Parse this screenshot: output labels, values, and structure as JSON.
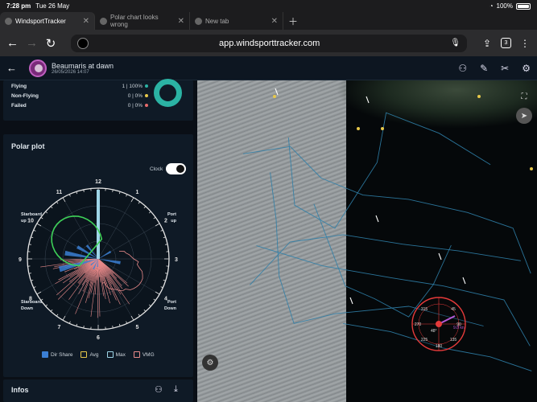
{
  "status": {
    "time": "7:28 pm",
    "date": "Tue 26 May",
    "battery": "100%"
  },
  "tabs": [
    {
      "label": "WindsportTracker",
      "active": true
    },
    {
      "label": "Polar chart looks wrong",
      "active": false
    },
    {
      "label": "New tab",
      "active": false
    }
  ],
  "address": {
    "url": "app.windsporttracker.com",
    "tab_count": "3"
  },
  "app": {
    "title": "Beaumaris at dawn",
    "subtitle": "26/05/2026 14:07"
  },
  "stats": [
    {
      "label": "Flying",
      "value": "1 | 100%",
      "color": "#2bb3a4"
    },
    {
      "label": "Non-Flying",
      "value": "0 | 0%",
      "color": "#e7c84a"
    },
    {
      "label": "Failed",
      "value": "0 | 0%",
      "color": "#e86b6b"
    }
  ],
  "polar": {
    "title": "Polar plot",
    "clock_label": "Clock",
    "clock_on": true,
    "hours": [
      "12",
      "1",
      "2",
      "3",
      "4",
      "5",
      "6",
      "7",
      "8",
      "9",
      "10",
      "11"
    ],
    "labels": {
      "starboard_up": "Starboard\nup",
      "port_up": "Port\nup",
      "starboard_down": "Starboard\nDown",
      "port_down": "Port\nDown"
    },
    "legend": [
      {
        "label": "Dir Share",
        "color": "#3b7fd4",
        "checked": true
      },
      {
        "label": "Avg",
        "color": "#e7c84a",
        "checked": false
      },
      {
        "label": "Max",
        "color": "#9fd6e8",
        "checked": false
      },
      {
        "label": "VMG",
        "color": "#e88a8a",
        "checked": false
      }
    ]
  },
  "infos": {
    "title": "Infos"
  },
  "map": {
    "compass_labels": [
      "315",
      "45",
      "90",
      "270",
      "135",
      "225",
      "180"
    ],
    "speed_label": "9.8 kn",
    "heading_label": "48°"
  }
}
